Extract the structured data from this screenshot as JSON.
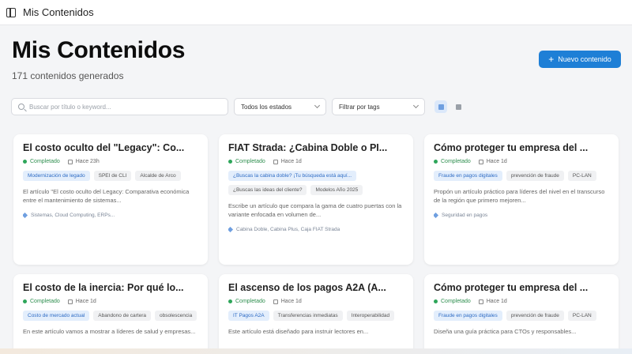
{
  "topbar": {
    "title": "Mis Contenidos"
  },
  "header": {
    "title": "Mis Contenidos",
    "subtitle": "171 contenidos generados"
  },
  "new_button": {
    "label": "Nuevo contenido",
    "icon": "plus-icon"
  },
  "filters": {
    "search_placeholder": "Buscar por título o keyword...",
    "status_select": "Todos los estados",
    "tag_select": "Filtrar por tags"
  },
  "colors": {
    "accent": "#1e7fd6",
    "status_green": "#2ea65a",
    "tag_blue": "#e3eefc"
  },
  "cards": [
    {
      "title": "El costo oculto del \"Legacy\": Co...",
      "status": "Completado",
      "date": "Hace 23h",
      "tags": [
        "Modernización de legado",
        "SPEI de CLI",
        "Alcalde de Arco"
      ],
      "description": "El artículo \"El costo oculto del Legacy: Comparativa económica entre el mantenimiento de sistemas...",
      "keywords": "Sistemas, Cloud Computing, ERPs..."
    },
    {
      "title": "FIAT Strada: ¿Cabina Doble o PI...",
      "status": "Completado",
      "date": "Hace 1d",
      "tags": [
        "¿Buscas la cabina doble? ¡Tu búsqueda está aquí...",
        "¿Buscas las ideas del cliente?",
        "Modelos Año 2025"
      ],
      "description": "Escribe un artículo que compara la gama de cuatro puertas con la variante enfocada en volumen de...",
      "keywords": "Cabina Doble, Cabina Plus, Caja FIAT Strada"
    },
    {
      "title": "Cómo proteger tu empresa del ...",
      "status": "Completado",
      "date": "Hace 1d",
      "tags": [
        "Fraude en pagos digitales",
        "prevención de fraude",
        "PC-LAN"
      ],
      "description": "Propón un artículo práctico para líderes del nivel en el transcurso de la región que primero mejoren...",
      "keywords": "Seguridad en pagos"
    },
    {
      "title": "El costo de la inercia: Por qué lo...",
      "status": "Completado",
      "date": "Hace 1d",
      "tags": [
        "Costo de mercado actual",
        "Abandono de cartera",
        "obsolescencia"
      ],
      "description": "En este artículo vamos a mostrar a líderes de salud y empresas...",
      "keywords": ""
    },
    {
      "title": "El ascenso de los pagos A2A (A...",
      "status": "Completado",
      "date": "Hace 1d",
      "tags": [
        "IT Pagos A2A",
        "Transferencias inmediatas",
        "Interoperabilidad"
      ],
      "description": "Este artículo está diseñado para instruir lectores en...",
      "keywords": ""
    },
    {
      "title": "Cómo proteger tu empresa del ...",
      "status": "Completado",
      "date": "Hace 1d",
      "tags": [
        "Fraude en pagos digitales",
        "prevención de fraude",
        "PC-LAN"
      ],
      "description": "Diseña una guía práctica para CTOs y responsables...",
      "keywords": ""
    }
  ]
}
